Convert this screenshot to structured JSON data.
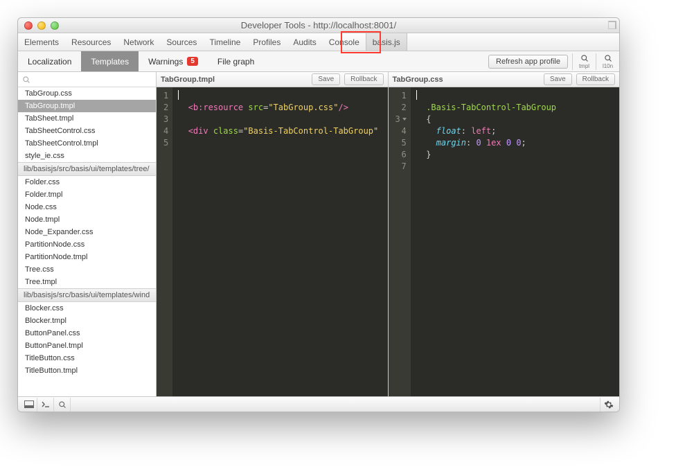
{
  "window_title": "Developer Tools - http://localhost:8001/",
  "devtabs": [
    "Elements",
    "Resources",
    "Network",
    "Sources",
    "Timeline",
    "Profiles",
    "Audits",
    "Console",
    "basis.js"
  ],
  "devtab_active": "basis.js",
  "highlight_tab": "basis.js",
  "subtabs": {
    "items": [
      {
        "label": "Localization",
        "badge": null
      },
      {
        "label": "Templates",
        "badge": null
      },
      {
        "label": "Warnings",
        "badge": "5"
      },
      {
        "label": "File graph",
        "badge": null
      }
    ],
    "active": "Templates"
  },
  "toolbar": {
    "refresh": "Refresh app profile",
    "icons": [
      {
        "name": "tmpl-search",
        "label": "tmpl"
      },
      {
        "name": "l10n-search",
        "label": "l10n"
      }
    ]
  },
  "search_placeholder": "",
  "sidebar": {
    "group1": {
      "files": [
        "TabGroup.css",
        "TabGroup.tmpl",
        "TabSheet.tmpl",
        "TabSheetControl.css",
        "TabSheetControl.tmpl",
        "style_ie.css"
      ],
      "selected": "TabGroup.tmpl"
    },
    "group2": {
      "header": "lib/basisjs/src/basis/ui/templates/tree/",
      "files": [
        "Folder.css",
        "Folder.tmpl",
        "Node.css",
        "Node.tmpl",
        "Node_Expander.css",
        "PartitionNode.css",
        "PartitionNode.tmpl",
        "Tree.css",
        "Tree.tmpl"
      ]
    },
    "group3": {
      "header": "lib/basisjs/src/basis/ui/templates/wind",
      "files": [
        "Blocker.css",
        "Blocker.tmpl",
        "ButtonPanel.css",
        "ButtonPanel.tmpl",
        "TitleButton.css",
        "TitleButton.tmpl"
      ]
    }
  },
  "editor_left": {
    "title": "TabGroup.tmpl",
    "btn_save": "Save",
    "btn_rollback": "Rollback",
    "line_numbers": [
      "1",
      "2",
      "3",
      "4",
      "5"
    ],
    "code": {
      "l2_tag_open": "<b:resource",
      "l2_attr": "src",
      "l2_str": "\"TabGroup.css\"",
      "l2_tag_close": "/>",
      "l4_tag_open": "<div",
      "l4_attr": "class",
      "l4_str": "\"Basis-TabControl-TabGroup\""
    }
  },
  "editor_right": {
    "title": "TabGroup.css",
    "btn_save": "Save",
    "btn_rollback": "Rollback",
    "line_numbers": [
      "1",
      "2",
      "3",
      "4",
      "5",
      "6",
      "7"
    ],
    "code": {
      "selector": ".Basis-TabControl-TabGroup",
      "brace_open": "{",
      "prop1": "float",
      "val1": "left",
      "prop2": "margin",
      "val2_num1": "0",
      "val2_kw": "1ex",
      "val2_num2": "0",
      "val2_num3": "0",
      "brace_close": "}"
    }
  }
}
